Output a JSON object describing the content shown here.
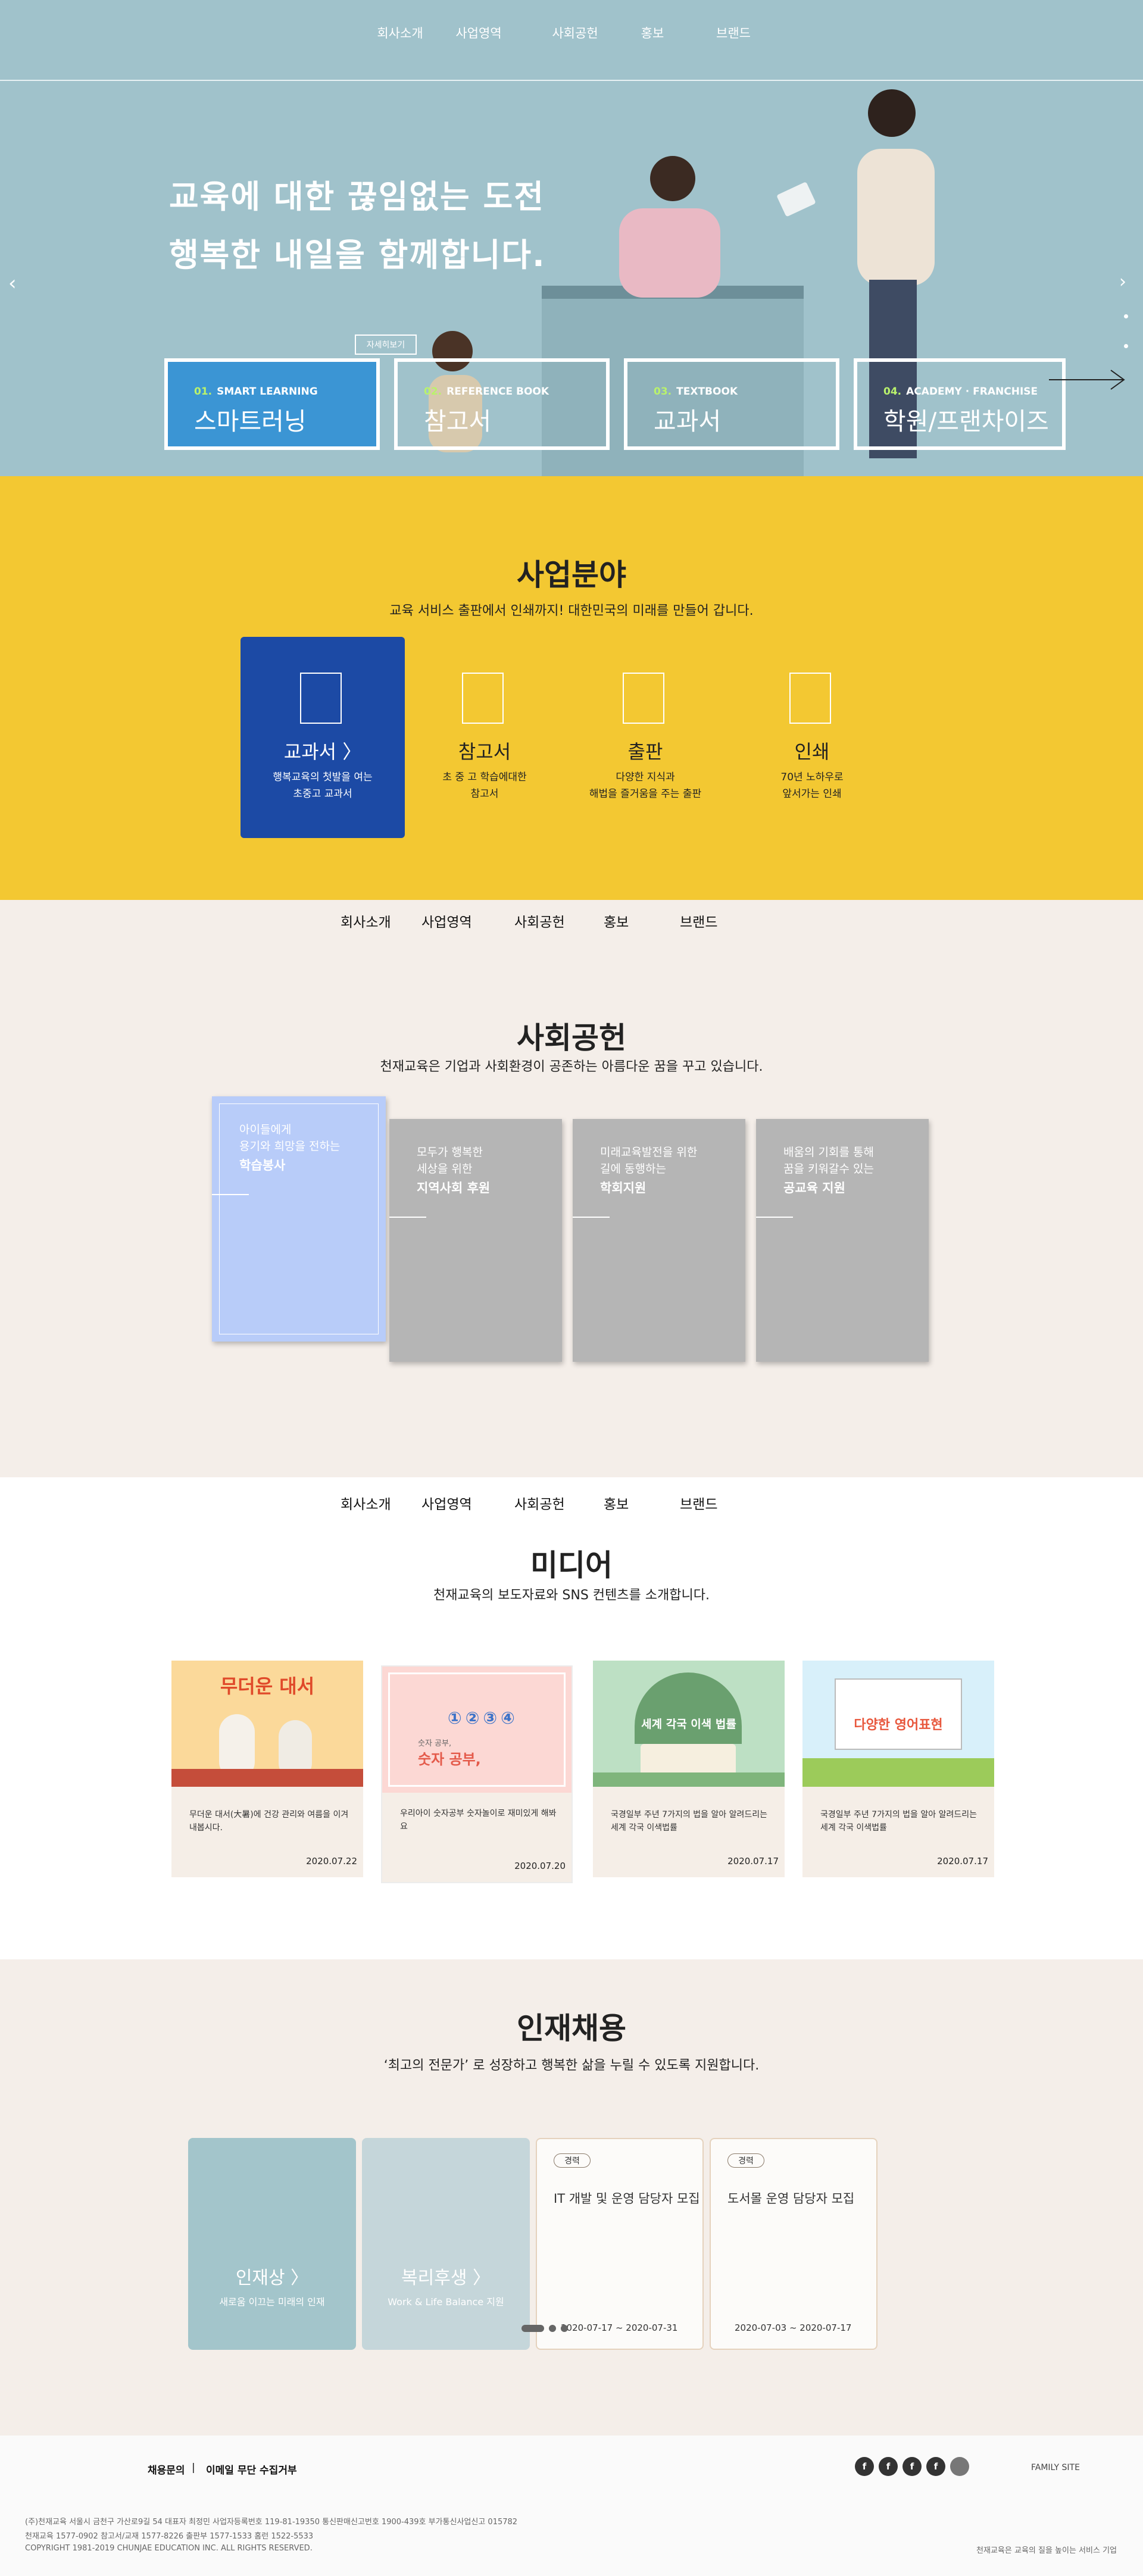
{
  "header": {
    "nav": [
      "회사소개",
      "사업영역",
      "사회공헌",
      "홍보",
      "브랜드"
    ]
  },
  "hero": {
    "title_line1": "교육에 대한 끊임없는 도전",
    "title_line2": "행복한 내일을 함께합니다.",
    "detail_button": "자세히보기",
    "cards": [
      {
        "num": "01.",
        "en": "SMART LEARNING",
        "name": "스마트러닝"
      },
      {
        "num": "02.",
        "en": "REFERENCE BOOK",
        "name": "참고서"
      },
      {
        "num": "03.",
        "en": "TEXTBOOK",
        "name": "교과서"
      },
      {
        "num": "04.",
        "en": "ACADEMY · FRANCHISE",
        "name": "학원/프랜차이즈"
      }
    ],
    "colors": {
      "bg": "#a0c2cb",
      "active_card": "#3b95d4",
      "accent_green": "#b9f26c"
    }
  },
  "business": {
    "title": "사업분야",
    "subtitle": "교육 서비스 출판에서 인쇄까지!  대한민국의 미래를 만들어 갑니다.",
    "cards": [
      {
        "name": "교과서 〉",
        "desc": "행복교육의 첫발을 여는\n초중고 교과서"
      },
      {
        "name": "참고서",
        "desc": "초 중 고 학습에대한\n참고서"
      },
      {
        "name": "출판",
        "desc": "다양한 지식과\n해법을 즐거움을 주는 출판"
      },
      {
        "name": "인쇄",
        "desc": "70년 노하우로\n앞서가는 인쇄"
      }
    ],
    "colors": {
      "bg": "#f3c832",
      "active_card": "#1c4aa5"
    }
  },
  "social": {
    "title": "사회공헌",
    "subtitle": "천재교육은 기업과 사회환경이 공존하는 아름다운 꿈을 꾸고 있습니다.",
    "cards": [
      {
        "line1": "아이들에게\n용기와 희망을 전하는",
        "line2": "학습봉사"
      },
      {
        "line1": "모두가 행복한\n세상을 위한",
        "line2": "지역사회 후원"
      },
      {
        "line1": "미래교육발전을 위한\n길에 동행하는",
        "line2": "학회지원"
      },
      {
        "line1": "배움의 기회를 통해\n꿈을 키워갈수 있는",
        "line2": "공교육 지원"
      }
    ]
  },
  "media": {
    "title": "미디어",
    "subtitle": "천재교육의 보도자료와  SNS 컨텐츠를 소개합니다.",
    "thumb_labels": [
      "무더운 대서",
      "숫자 공부,",
      "세계 각국 이색 법률",
      "다양한 영어표현"
    ],
    "thumb_small_label": "숫자 공부,",
    "cards": [
      {
        "text": "무더운 대서(大暑)에 건강 관리와 여름을 이겨내봅시다.",
        "date": "2020.07.22"
      },
      {
        "text": "우리아이 숫자공부 숫자놀이로 재미있게 해봐요",
        "date": "2020.07.20"
      },
      {
        "text": "국경일부 주년 7가지의 법을 알아 알려드리는 세계 각국 이색법률",
        "date": "2020.07.17"
      },
      {
        "text": "국경일부 주년 7가지의 법을 알아 알려드리는 세계 각국 이색법률",
        "date": "2020.07.17"
      }
    ]
  },
  "recruit": {
    "title": "인재채용",
    "subtitle": "‘최고의 전문가’ 로 성장하고 행복한 삶을 누릴 수 있도록 지원합니다.",
    "cards": [
      {
        "title": "인재상 〉",
        "sub": "새로움 이끄는 미래의 인재"
      },
      {
        "title": "복리후생 〉",
        "sub": "Work & Life Balance 지원"
      }
    ],
    "jobs": [
      {
        "badge": "경력",
        "title": "IT 개발 및 운영 담당자 모집",
        "date": "2020-07-17 ~ 2020-07-31"
      },
      {
        "badge": "경력",
        "title": "도서몰 운영 담당자 모집",
        "date": "2020-07-03 ~ 2020-07-17"
      }
    ]
  },
  "footer": {
    "links": [
      "채용문의",
      "|",
      "이메일 무단 수집거부"
    ],
    "sns": [
      "f",
      "f",
      "f",
      "f"
    ],
    "family_site": "FAMILY SITE",
    "info_line1": "(주)천재교육  서울시 금천구 가산로9길 54  대표자 최정민  사업자등록번호 119-81-19350  통신판매신고번호 1900-439호  부가통신사업신고 015782",
    "info_line2": "천재교육 1577-0902  참고서/교재 1577-8226  출판부 1577-1533  홈런 1522-5533",
    "copyright": "COPYRIGHT 1981-2019 CHUNJAE EDUCATION INC. ALL RIGHTS RESERVED.",
    "right_text": "천재교육은 교육의 질을 높이는 서비스 기업"
  }
}
